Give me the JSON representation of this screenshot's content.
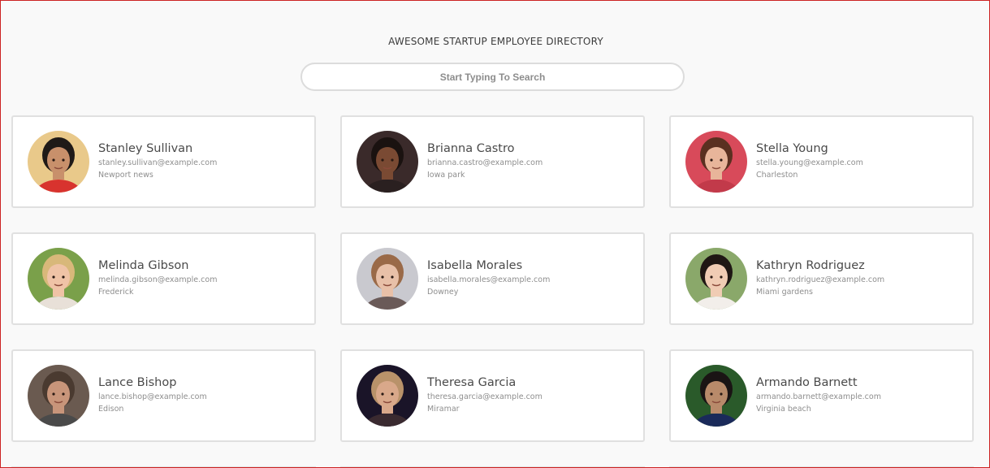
{
  "directory": {
    "title": "AWESOME STARTUP EMPLOYEE DIRECTORY",
    "search_placeholder": "Start Typing To Search"
  },
  "employees": [
    {
      "name": "Stanley Sullivan",
      "email": "stanley.sullivan@example.com",
      "city": "Newport news"
    },
    {
      "name": "Brianna Castro",
      "email": "brianna.castro@example.com",
      "city": "Iowa park"
    },
    {
      "name": "Stella Young",
      "email": "stella.young@example.com",
      "city": "Charleston"
    },
    {
      "name": "Melinda Gibson",
      "email": "melinda.gibson@example.com",
      "city": "Frederick"
    },
    {
      "name": "Isabella Morales",
      "email": "isabella.morales@example.com",
      "city": "Downey"
    },
    {
      "name": "Kathryn Rodriguez",
      "email": "kathryn.rodriguez@example.com",
      "city": "Miami gardens"
    },
    {
      "name": "Lance Bishop",
      "email": "lance.bishop@example.com",
      "city": "Edison"
    },
    {
      "name": "Theresa Garcia",
      "email": "theresa.garcia@example.com",
      "city": "Miramar"
    },
    {
      "name": "Armando Barnett",
      "email": "armando.barnett@example.com",
      "city": "Virginia beach"
    }
  ],
  "avatar_palette": [
    {
      "bg": "#e9c98a",
      "hair": "#1f1a17",
      "skin": "#c8906b",
      "shirt": "#d8332e"
    },
    {
      "bg": "#3a2a2a",
      "hair": "#1a1210",
      "skin": "#7a4a33",
      "shirt": "#2a2020"
    },
    {
      "bg": "#d84a5a",
      "hair": "#5a3020",
      "skin": "#e8b59a",
      "shirt": "#c23a4a"
    },
    {
      "bg": "#7aa04a",
      "hair": "#d8b87a",
      "skin": "#efc3a6",
      "shirt": "#e8e0d8"
    },
    {
      "bg": "#c9c9cf",
      "hair": "#9a6a48",
      "skin": "#e8c0a8",
      "shirt": "#6a5a58"
    },
    {
      "bg": "#8aa86a",
      "hair": "#1f1714",
      "skin": "#f0ccb4",
      "shirt": "#f2eeea"
    },
    {
      "bg": "#6a5a50",
      "hair": "#4a3a30",
      "skin": "#c8957a",
      "shirt": "#4a4a4a"
    },
    {
      "bg": "#1a1428",
      "hair": "#b9926a",
      "skin": "#d9a88a",
      "shirt": "#3a2a30"
    },
    {
      "bg": "#2a5a2a",
      "hair": "#1a1414",
      "skin": "#b88a6a",
      "shirt": "#1a2a5a"
    }
  ]
}
